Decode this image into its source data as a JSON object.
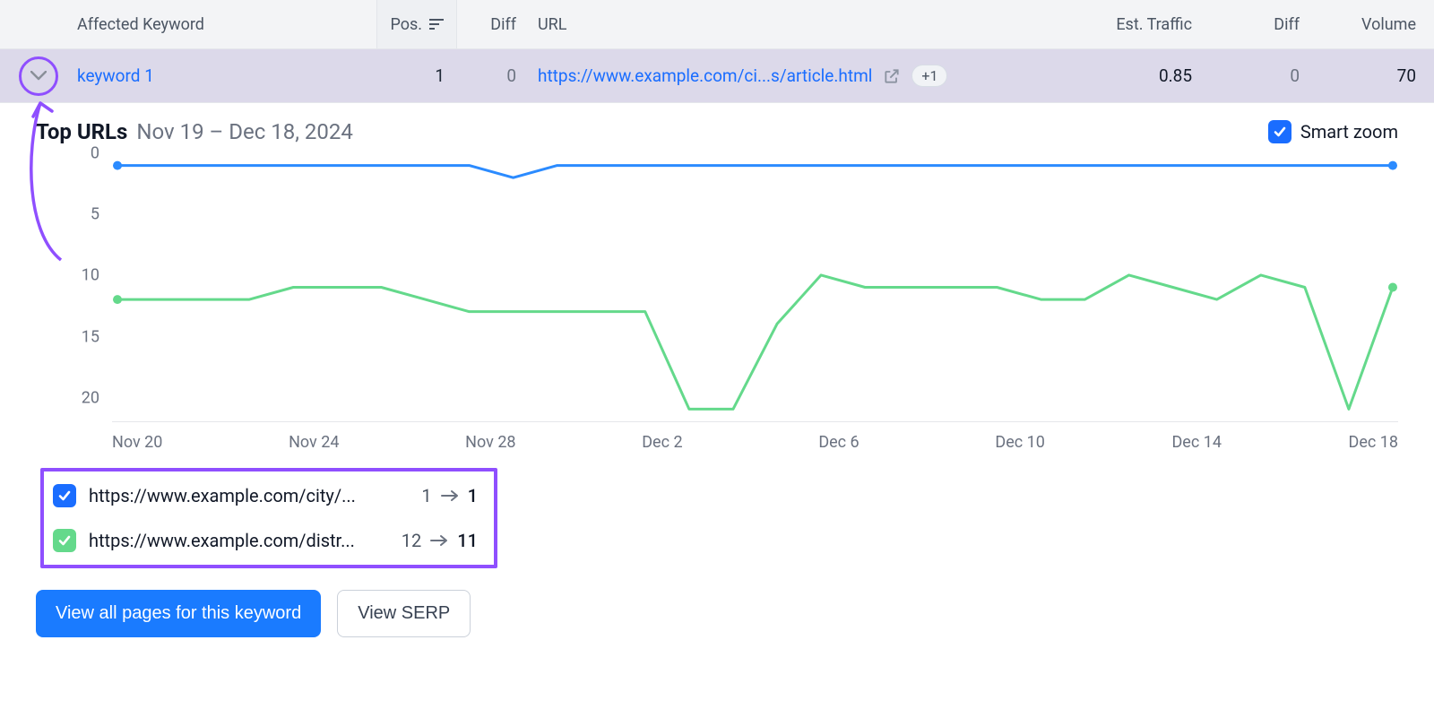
{
  "table": {
    "headers": {
      "keyword": "Affected Keyword",
      "pos": "Pos.",
      "diff1": "Diff",
      "url": "URL",
      "est_traffic": "Est. Traffic",
      "diff2": "Diff",
      "volume": "Volume"
    },
    "row": {
      "keyword": "keyword 1",
      "pos": "1",
      "diff1": "0",
      "url_text": "https://www.example.com/ci...s/article.html",
      "plus_badge": "+1",
      "est_traffic": "0.85",
      "diff2": "0",
      "volume": "70"
    }
  },
  "panel": {
    "title": "Top URLs",
    "date_range": "Nov 19 – Dec 18, 2024",
    "smart_zoom": "Smart zoom"
  },
  "chart_data": {
    "type": "line",
    "ylabel": "",
    "ylim": [
      0,
      22
    ],
    "y_inverted": true,
    "y_ticks": [
      0,
      5,
      10,
      15,
      20
    ],
    "x_tick_labels": [
      "Nov 20",
      "Nov 24",
      "Nov 28",
      "Dec 2",
      "Dec 6",
      "Dec 10",
      "Dec 14",
      "Dec 18"
    ],
    "x": [
      "Nov 19",
      "Nov 20",
      "Nov 21",
      "Nov 22",
      "Nov 23",
      "Nov 24",
      "Nov 25",
      "Nov 26",
      "Nov 27",
      "Nov 28",
      "Nov 29",
      "Nov 30",
      "Dec 1",
      "Dec 2",
      "Dec 3",
      "Dec 4",
      "Dec 5",
      "Dec 6",
      "Dec 7",
      "Dec 8",
      "Dec 9",
      "Dec 10",
      "Dec 11",
      "Dec 12",
      "Dec 13",
      "Dec 14",
      "Dec 15",
      "Dec 16",
      "Dec 17",
      "Dec 18"
    ],
    "series": [
      {
        "name": "https://www.example.com/city/...",
        "color": "#2b8bff",
        "values": [
          1,
          1,
          1,
          1,
          1,
          1,
          1,
          1,
          1,
          2,
          1,
          1,
          1,
          1,
          1,
          1,
          1,
          1,
          1,
          1,
          1,
          1,
          1,
          1,
          1,
          1,
          1,
          1,
          1,
          1
        ]
      },
      {
        "name": "https://www.example.com/distr...",
        "color": "#64d98b",
        "values": [
          12,
          12,
          12,
          12,
          11,
          11,
          11,
          12,
          13,
          13,
          13,
          13,
          13,
          21,
          21,
          14,
          10,
          11,
          11,
          11,
          11,
          12,
          12,
          10,
          11,
          12,
          10,
          11,
          21,
          11
        ]
      }
    ]
  },
  "legend": {
    "items": [
      {
        "color": "blue",
        "label": "https://www.example.com/city/...",
        "from": "1",
        "to": "1"
      },
      {
        "color": "green",
        "label": "https://www.example.com/distr...",
        "from": "12",
        "to": "11"
      }
    ]
  },
  "buttons": {
    "view_all": "View all pages for this keyword",
    "view_serp": "View SERP"
  }
}
